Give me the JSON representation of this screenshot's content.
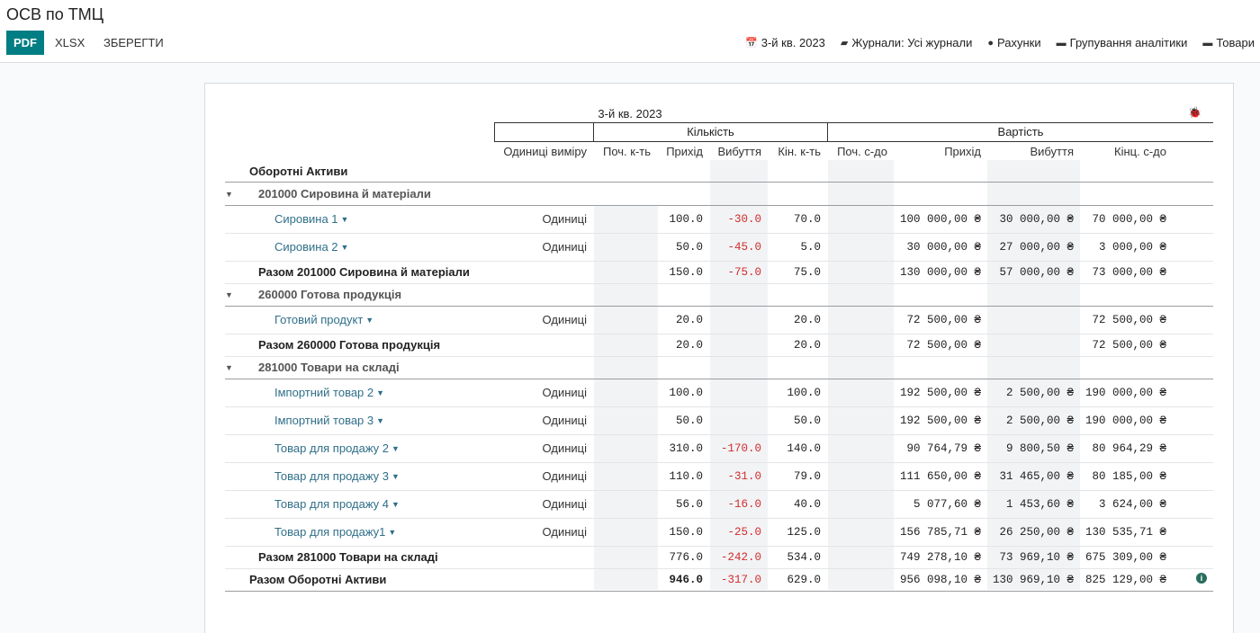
{
  "app": {
    "title": "ОСВ по ТМЦ"
  },
  "toolbar": {
    "pdf": "PDF",
    "xlsx": "XLSX",
    "save": "ЗБЕРЕГТИ"
  },
  "filters": [
    {
      "icon": "calendar-icon",
      "label": "3-й кв. 2023"
    },
    {
      "icon": "book-icon",
      "label": "Журнали: Усі журнали"
    },
    {
      "icon": "user-icon",
      "label": "Рахунки"
    },
    {
      "icon": "folder-icon",
      "label": "Групування аналітики"
    },
    {
      "icon": "folder-icon",
      "label": "Товари"
    }
  ],
  "report": {
    "period": "3-й кв. 2023",
    "group_qty": "Кількість",
    "group_value": "Вартість",
    "columns": [
      "Одиниці виміру",
      "Поч. к-ть",
      "Прихід",
      "Вибуття",
      "Кін. к-ть",
      "Поч. с-до",
      "Прихід",
      "Вибуття",
      "Кінц. с-до"
    ],
    "section": "Оборотні Активи",
    "groups": [
      {
        "name": "201000 Сировина й матеріали",
        "lines": [
          {
            "name": "Сировина 1",
            "unit": "Одиниці",
            "in": "100.0",
            "out": "-30.0",
            "end": "70.0",
            "vin": "100 000,00 ₴",
            "vout": "30 000,00 ₴",
            "vend": "70 000,00 ₴"
          },
          {
            "name": "Сировина 2",
            "unit": "Одиниці",
            "in": "50.0",
            "out": "-45.0",
            "end": "5.0",
            "vin": "30 000,00 ₴",
            "vout": "27 000,00 ₴",
            "vend": "3 000,00 ₴"
          }
        ],
        "total": {
          "name": "Разом 201000 Сировина й матеріали",
          "in": "150.0",
          "out": "-75.0",
          "end": "75.0",
          "vin": "130 000,00 ₴",
          "vout": "57 000,00 ₴",
          "vend": "73 000,00 ₴"
        }
      },
      {
        "name": "260000 Готова продукція",
        "lines": [
          {
            "name": "Готовий продукт",
            "unit": "Одиниці",
            "in": "20.0",
            "out": "",
            "end": "20.0",
            "vin": "72 500,00 ₴",
            "vout": "",
            "vend": "72 500,00 ₴"
          }
        ],
        "total": {
          "name": "Разом 260000 Готова продукція",
          "in": "20.0",
          "out": "",
          "end": "20.0",
          "vin": "72 500,00 ₴",
          "vout": "",
          "vend": "72 500,00 ₴"
        }
      },
      {
        "name": "281000 Товари на складі",
        "lines": [
          {
            "name": "Імпортний товар 2",
            "unit": "Одиниці",
            "in": "100.0",
            "out": "",
            "end": "100.0",
            "vin": "192 500,00 ₴",
            "vout": "2 500,00 ₴",
            "vend": "190 000,00 ₴"
          },
          {
            "name": "Імпортний товар 3",
            "unit": "Одиниці",
            "in": "50.0",
            "out": "",
            "end": "50.0",
            "vin": "192 500,00 ₴",
            "vout": "2 500,00 ₴",
            "vend": "190 000,00 ₴"
          },
          {
            "name": "Товар для продажу 2",
            "unit": "Одиниці",
            "in": "310.0",
            "out": "-170.0",
            "end": "140.0",
            "vin": "90 764,79 ₴",
            "vout": "9 800,50 ₴",
            "vend": "80 964,29 ₴"
          },
          {
            "name": "Товар для продажу 3",
            "unit": "Одиниці",
            "in": "110.0",
            "out": "-31.0",
            "end": "79.0",
            "vin": "111 650,00 ₴",
            "vout": "31 465,00 ₴",
            "vend": "80 185,00 ₴"
          },
          {
            "name": "Товар для продажу 4",
            "unit": "Одиниці",
            "in": "56.0",
            "out": "-16.0",
            "end": "40.0",
            "vin": "5 077,60 ₴",
            "vout": "1 453,60 ₴",
            "vend": "3 624,00 ₴"
          },
          {
            "name": "Товар для продажу1",
            "unit": "Одиниці",
            "in": "150.0",
            "out": "-25.0",
            "end": "125.0",
            "vin": "156 785,71 ₴",
            "vout": "26 250,00 ₴",
            "vend": "130 535,71 ₴"
          }
        ],
        "total": {
          "name": "Разом 281000 Товари на складі",
          "in": "776.0",
          "out": "-242.0",
          "end": "534.0",
          "vin": "749 278,10 ₴",
          "vout": "73 969,10 ₴",
          "vend": "675 309,00 ₴"
        }
      }
    ],
    "grand_total": {
      "name": "Разом Оборотні Активи",
      "in": "946.0",
      "out": "-317.0",
      "end": "629.0",
      "vin": "956 098,10 ₴",
      "vout": "130 969,10 ₴",
      "vend": "825 129,00 ₴"
    }
  }
}
